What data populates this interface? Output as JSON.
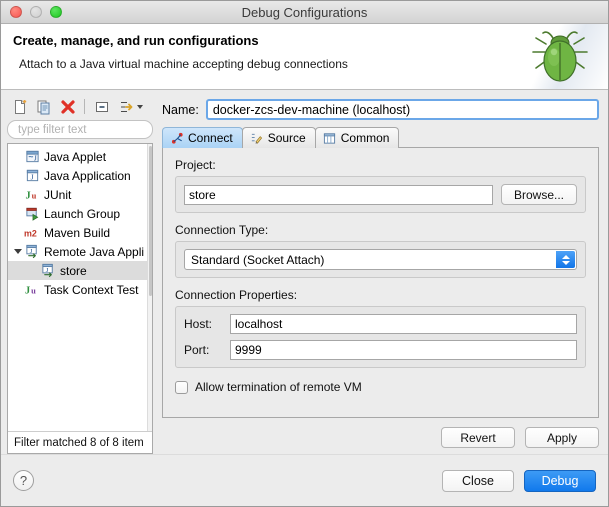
{
  "window": {
    "title": "Debug Configurations",
    "traffic_lights": [
      "close-red",
      "minimize-gray",
      "zoom-green"
    ]
  },
  "header": {
    "title": "Create, manage, and run configurations",
    "subtitle": "Attach to a Java virtual machine accepting debug connections",
    "art_icon": "green-bug-icon"
  },
  "toolbar": {
    "buttons": [
      {
        "name": "new-configuration-icon",
        "tooltip": "New launch configuration"
      },
      {
        "name": "duplicate-configuration-icon",
        "tooltip": "Duplicate currently selected launch configuration"
      },
      {
        "name": "delete-configuration-icon",
        "tooltip": "Delete selected launch configuration(s)"
      },
      {
        "name": "collapse-all-icon",
        "tooltip": "Collapse All"
      },
      {
        "name": "filter-launch-configurations-icon",
        "tooltip": "Filter launch configurations"
      }
    ]
  },
  "filter": {
    "placeholder": "type filter text",
    "value": ""
  },
  "tree": {
    "items": [
      {
        "label": "Java Applet",
        "icon": "java-applet-icon",
        "depth": 0,
        "expandable": false,
        "selected": false
      },
      {
        "label": "Java Application",
        "icon": "java-application-icon",
        "depth": 0,
        "expandable": false,
        "selected": false
      },
      {
        "label": "JUnit",
        "icon": "junit-icon",
        "depth": 0,
        "expandable": false,
        "selected": false
      },
      {
        "label": "Launch Group",
        "icon": "launch-group-icon",
        "depth": 0,
        "expandable": false,
        "selected": false
      },
      {
        "label": "Maven Build",
        "icon": "maven-build-icon",
        "depth": 0,
        "expandable": false,
        "selected": false
      },
      {
        "label": "Remote Java Appli",
        "icon": "remote-java-application-icon",
        "depth": 0,
        "expandable": true,
        "expanded": true,
        "selected": false
      },
      {
        "label": "store",
        "icon": "remote-java-application-icon",
        "depth": 1,
        "expandable": false,
        "selected": true
      },
      {
        "label": "Task Context Test",
        "icon": "task-context-test-icon",
        "depth": 0,
        "expandable": false,
        "selected": false
      }
    ],
    "status": "Filter matched 8 of 8 item"
  },
  "name_field": {
    "label": "Name:",
    "value": "docker-zcs-dev-machine (localhost)",
    "placeholder": ""
  },
  "tabs": [
    {
      "label": "Connect",
      "icon": "connect-icon",
      "active": true
    },
    {
      "label": "Source",
      "icon": "source-icon",
      "active": false
    },
    {
      "label": "Common",
      "icon": "common-icon",
      "active": false
    }
  ],
  "connect_tab": {
    "project": {
      "label": "Project:",
      "value": "store",
      "browse_label": "Browse..."
    },
    "connection_type": {
      "label": "Connection Type:",
      "value": "Standard (Socket Attach)"
    },
    "connection_properties": {
      "label": "Connection Properties:",
      "host_label": "Host:",
      "host_value": "localhost",
      "port_label": "Port:",
      "port_value": "9999"
    },
    "allow_termination": {
      "label": "Allow termination of remote VM",
      "checked": false
    },
    "revert_label": "Revert",
    "apply_label": "Apply"
  },
  "footer": {
    "help_label": "?",
    "close_label": "Close",
    "debug_label": "Debug"
  },
  "colors": {
    "accent_blue": "#1179ec",
    "tab_active": "#aad3f5",
    "delete_red": "#e03127",
    "bug_green": "#5aa43a",
    "selection_gray": "#dcdcdc"
  }
}
